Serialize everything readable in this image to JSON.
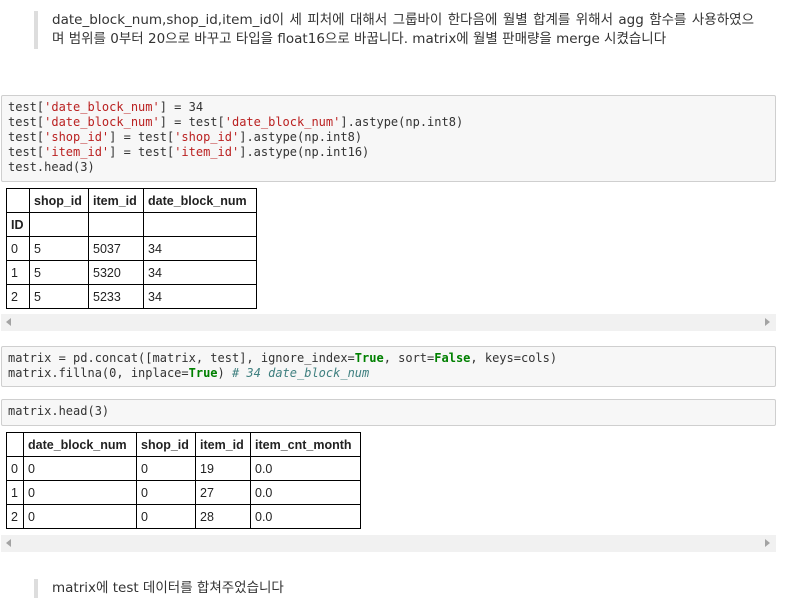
{
  "markdown": {
    "first": "date_block_num,shop_id,item_id이 세 피처에 대해서 그룹바이 한다음에 월별 합계를 위해서 agg 함수를 사용하였으며 범위를 0부터 20으로 바꾸고 타입을 float16으로 바꿉니다. matrix에 월별 판매량을 merge 시켰습니다",
    "second": "matrix에 test 데이터를 합쳐주었습니다"
  },
  "code_cell_1": {
    "l1a": "test[",
    "l1s": "'date_block_num'",
    "l1b": "] = 34",
    "l2a": "test[",
    "l2s": "'date_block_num'",
    "l2b": "] = test[",
    "l2s2": "'date_block_num'",
    "l2c": "].astype(np.int8)",
    "l3a": "test[",
    "l3s": "'shop_id'",
    "l3b": "] = test[",
    "l3s2": "'shop_id'",
    "l3c": "].astype(np.int8)",
    "l4a": "test[",
    "l4s": "'item_id'",
    "l4b": "] = test[",
    "l4s2": "'item_id'",
    "l4c": "].astype(np.int16)",
    "l5": "test.head(3)"
  },
  "output_1": {
    "columns": [
      "",
      "shop_id",
      "item_id",
      "date_block_num"
    ],
    "index_name": "ID",
    "rows": [
      [
        "0",
        "5",
        "5037",
        "34"
      ],
      [
        "1",
        "5",
        "5320",
        "34"
      ],
      [
        "2",
        "5",
        "5233",
        "34"
      ]
    ]
  },
  "code_cell_2": {
    "l1a": "matrix = pd.concat([matrix, test], ignore_index=",
    "l1k1": "True",
    "l1b": ", sort=",
    "l1k2": "False",
    "l1c": ", keys=cols)",
    "l2a": "matrix.fillna(0, inplace=",
    "l2k": "True",
    "l2b": ") ",
    "l2cm": "# 34 date_block_num"
  },
  "code_cell_3": {
    "l1": "matrix.head(3)"
  },
  "output_2": {
    "columns": [
      "",
      "date_block_num",
      "shop_id",
      "item_id",
      "item_cnt_month"
    ],
    "rows": [
      [
        "0",
        "0",
        "0",
        "19",
        "0.0"
      ],
      [
        "1",
        "0",
        "0",
        "27",
        "0.0"
      ],
      [
        "2",
        "0",
        "0",
        "28",
        "0.0"
      ]
    ]
  },
  "icons": {
    "scroll_left": "scroll-left-arrow-icon",
    "scroll_right": "scroll-right-arrow-icon"
  }
}
